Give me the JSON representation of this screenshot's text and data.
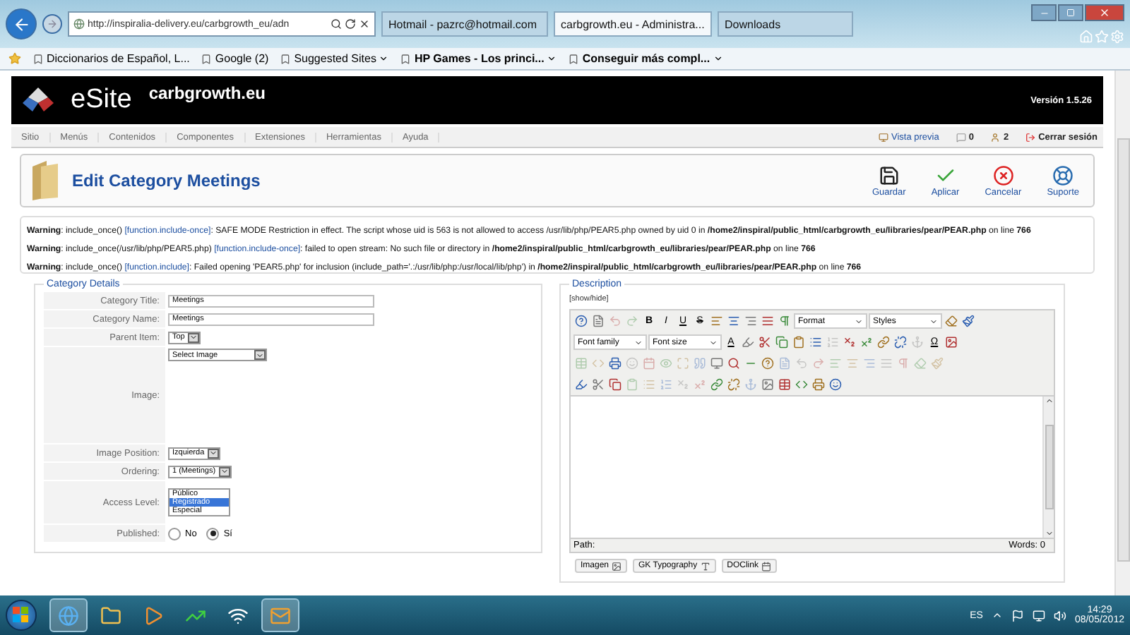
{
  "browser": {
    "address": "http://inspiralia-delivery.eu/carbgrowth_eu/adn",
    "tabs": [
      {
        "label": "Hotmail - pazrc@hotmail.com",
        "selected": false
      },
      {
        "label": "carbgrowth.eu - Administra...",
        "selected": true
      },
      {
        "label": "Downloads",
        "selected": false
      }
    ],
    "favorites": [
      {
        "label": "Diccionarios de Español, L...",
        "dropdown": false
      },
      {
        "label": "Google (2)",
        "dropdown": false
      },
      {
        "label": "Suggested Sites",
        "dropdown": true
      },
      {
        "label": "HP Games - Los princi...",
        "dropdown": true
      },
      {
        "label": "Conseguir más compl...",
        "dropdown": true
      }
    ]
  },
  "header": {
    "logo": "eSite",
    "site": "carbgrowth.eu",
    "version": "Versión 1.5.26"
  },
  "menu": {
    "items": [
      "Sitio",
      "Menús",
      "Contenidos",
      "Componentes",
      "Extensiones",
      "Herramientas",
      "Ayuda"
    ],
    "status": [
      {
        "kind": "preview",
        "label": "Vista previa"
      },
      {
        "kind": "messages",
        "label": "0"
      },
      {
        "kind": "users",
        "label": "2"
      },
      {
        "kind": "logout",
        "label": "Cerrar sesión"
      }
    ]
  },
  "toolbar": {
    "title": "Edit Category Meetings",
    "buttons": [
      {
        "kind": "save",
        "label": "Guardar"
      },
      {
        "kind": "apply",
        "label": "Aplicar"
      },
      {
        "kind": "cancel",
        "label": "Cancelar"
      },
      {
        "kind": "support",
        "label": "Suporte"
      }
    ]
  },
  "warnings": [
    {
      "before": "**Warning**: include_once() ",
      "link": "[function.include-once]",
      "after": ": SAFE MODE Restriction in effect. The script whose uid is 563 is not allowed to access /usr/lib/php/PEAR5.php owned by uid 0 in **/home2/inspiral/public_html/carbgrowth_eu/libraries/pear/PEAR.php** on line **766**"
    },
    {
      "before": "**Warning**: include_once(/usr/lib/php/PEAR5.php) ",
      "link": "[function.include-once]",
      "after": ": failed to open stream: No such file or directory in **/home2/inspiral/public_html/carbgrowth_eu/libraries/pear/PEAR.php** on line **766**"
    },
    {
      "before": "**Warning**: include_once() ",
      "link": "[function.include]",
      "after": ": Failed opening 'PEAR5.php' for inclusion (include_path='.:/usr/lib/php:/usr/local/lib/php') in **/home2/inspiral/public_html/carbgrowth_eu/libraries/pear/PEAR.php** on line **766**"
    }
  ],
  "details": {
    "legend": "Category Details",
    "fields": [
      {
        "kind": "text",
        "label": "Category Title:",
        "value": "Meetings"
      },
      {
        "kind": "text",
        "label": "Category Name:",
        "value": "Meetings"
      },
      {
        "kind": "select",
        "label": "Parent Item:",
        "value": "Top"
      },
      {
        "kind": "image",
        "label": "Image:",
        "value": "Select Image"
      },
      {
        "kind": "select",
        "label": "Image Position:",
        "value": "Izquierda"
      },
      {
        "kind": "select",
        "label": "Ordering:",
        "value": "1 (Meetings)"
      },
      {
        "kind": "list",
        "label": "Access Level:",
        "options": [
          {
            "label": "Público",
            "selected": false
          },
          {
            "label": "Registrado",
            "selected": true
          },
          {
            "label": "Especial",
            "selected": false
          }
        ]
      },
      {
        "kind": "radio",
        "label": "Published:",
        "options": [
          {
            "label": "No",
            "selected": false
          },
          {
            "label": "Sí",
            "selected": true
          }
        ]
      }
    ]
  },
  "description": {
    "legend": "Description",
    "toggle": "[show/hide]",
    "toolbar": [
      [
        {
          "kind": "icon"
        },
        {
          "kind": "icon"
        },
        {
          "kind": "icon",
          "disabled": true
        },
        {
          "kind": "icon",
          "disabled": true
        },
        {
          "kind": "letter",
          "label": "B"
        },
        {
          "kind": "letter",
          "label": "I"
        },
        {
          "kind": "letter",
          "label": "U"
        },
        {
          "kind": "letter",
          "label": "S"
        },
        {
          "kind": "icon"
        },
        {
          "kind": "icon"
        },
        {
          "kind": "icon"
        },
        {
          "kind": "icon"
        },
        {
          "kind": "icon"
        },
        {
          "kind": "select",
          "label": "Format"
        },
        {
          "kind": "select",
          "label": "Styles"
        },
        {
          "kind": "icon"
        },
        {
          "kind": "icon"
        }
      ],
      [
        {
          "kind": "select",
          "label": "Font family"
        },
        {
          "kind": "select",
          "label": "Font size"
        },
        {
          "kind": "letter",
          "label": "A"
        },
        {
          "kind": "icon"
        },
        {
          "kind": "icon"
        },
        {
          "kind": "icon"
        },
        {
          "kind": "icon"
        },
        {
          "kind": "icon"
        },
        {
          "kind": "icon",
          "disabled": true
        },
        {
          "kind": "icon"
        },
        {
          "kind": "icon"
        },
        {
          "kind": "icon"
        },
        {
          "kind": "icon"
        },
        {
          "kind": "icon",
          "disabled": true
        },
        {
          "kind": "letter",
          "label": "Ω"
        },
        {
          "kind": "icon"
        }
      ],
      [
        {
          "kind": "icon",
          "disabled": true
        },
        {
          "kind": "icon",
          "disabled": true
        },
        {
          "kind": "icon"
        },
        {
          "kind": "icon",
          "disabled": true
        },
        {
          "kind": "icon",
          "disabled": true
        },
        {
          "kind": "icon",
          "disabled": true
        },
        {
          "kind": "icon",
          "disabled": true
        },
        {
          "kind": "icon",
          "disabled": true
        },
        {
          "kind": "icon"
        },
        {
          "kind": "icon"
        },
        {
          "kind": "icon"
        },
        {
          "kind": "icon"
        },
        {
          "kind": "icon",
          "disabled": true
        },
        {
          "kind": "icon",
          "disabled": true
        },
        {
          "kind": "icon",
          "disabled": true
        },
        {
          "kind": "icon",
          "disabled": true
        },
        {
          "kind": "icon",
          "disabled": true
        },
        {
          "kind": "icon",
          "disabled": true
        },
        {
          "kind": "icon",
          "disabled": true
        },
        {
          "kind": "icon",
          "disabled": true
        },
        {
          "kind": "icon",
          "disabled": true
        },
        {
          "kind": "icon",
          "disabled": true
        }
      ],
      [
        {
          "kind": "icon"
        },
        {
          "kind": "icon"
        },
        {
          "kind": "icon"
        },
        {
          "kind": "icon",
          "disabled": true
        },
        {
          "kind": "icon",
          "disabled": true
        },
        {
          "kind": "icon",
          "disabled": true
        },
        {
          "kind": "icon",
          "disabled": true
        },
        {
          "kind": "icon",
          "disabled": true
        },
        {
          "kind": "icon"
        },
        {
          "kind": "icon"
        },
        {
          "kind": "icon",
          "disabled": true
        },
        {
          "kind": "icon"
        },
        {
          "kind": "icon"
        },
        {
          "kind": "icon"
        },
        {
          "kind": "icon"
        },
        {
          "kind": "icon"
        }
      ]
    ],
    "path": "Path:",
    "words": "Words: 0",
    "buttons": [
      {
        "kind": "image",
        "label": "Imagen"
      },
      {
        "kind": "typography",
        "label": "GK Typography"
      },
      {
        "kind": "doclink",
        "label": "DOClink"
      }
    ]
  },
  "taskbar": {
    "apps": [
      {
        "kind": "browser",
        "running": true
      },
      {
        "kind": "folder",
        "running": false
      },
      {
        "kind": "media",
        "running": false
      },
      {
        "kind": "chart",
        "running": false
      },
      {
        "kind": "wifi",
        "running": false
      },
      {
        "kind": "mail",
        "running": true
      }
    ],
    "language": "ES",
    "time": "14:29",
    "date": "08/05/2012"
  }
}
